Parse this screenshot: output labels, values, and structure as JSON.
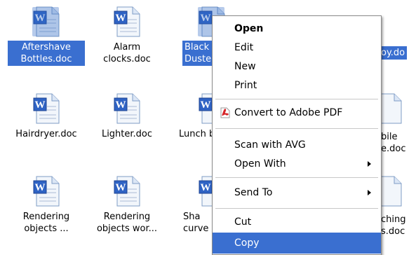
{
  "desktop": {
    "items": [
      {
        "label": "Aftershave Bottles.doc"
      },
      {
        "label": "Alarm clocks.doc"
      },
      {
        "label": "Black Duste"
      },
      {
        "label": "oy.do"
      },
      {
        "label": "Hairdryer.doc"
      },
      {
        "label": "Lighter.doc"
      },
      {
        "label": "Lunch b"
      },
      {
        "label": "bile e.doc"
      },
      {
        "label": "Rendering objects ..."
      },
      {
        "label": "Rendering objects wor..."
      },
      {
        "label": "Sha curve"
      },
      {
        "label": "ching s.doc"
      }
    ]
  },
  "context_menu": {
    "items": [
      {
        "label": "Open"
      },
      {
        "label": "Edit"
      },
      {
        "label": "New"
      },
      {
        "label": "Print"
      },
      {
        "label": "Convert to Adobe PDF",
        "icon": "pdf-icon"
      },
      {
        "label": "Scan with AVG"
      },
      {
        "label": "Open With"
      },
      {
        "label": "Send To"
      },
      {
        "label": "Cut"
      },
      {
        "label": "Copy"
      }
    ]
  },
  "colors": {
    "selection": "#3a6fd0",
    "word_icon_blue": "#2f63c4",
    "pdf_red": "#d6262a"
  }
}
